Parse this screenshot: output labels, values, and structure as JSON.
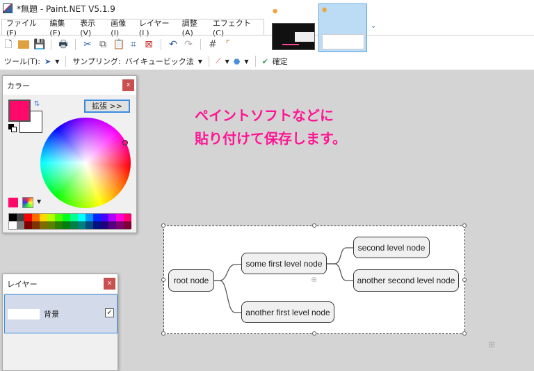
{
  "window": {
    "title": "*無題 - Paint.NET V5.1.9"
  },
  "menu": [
    "ファイル(F)",
    "編集(E)",
    "表示(V)",
    "画像(I)",
    "レイヤー(L)",
    "調整(A)",
    "エフェクト(C)"
  ],
  "toolbar2": {
    "tool_label": "ツール(T):",
    "sampling_label": "サンプリング:",
    "sampling_value": "バイキュービック法",
    "commit_label": "確定"
  },
  "color_panel": {
    "title": "カラー",
    "expand_label": "拡張 >>",
    "close": "x",
    "primary_color": "#ff0a6b",
    "secondary_color": "#ffffff",
    "palette_top": [
      "#000000",
      "#404040",
      "#ff0000",
      "#ff6a00",
      "#ffd800",
      "#b6ff00",
      "#4cff00",
      "#00ff21",
      "#00ff90",
      "#00ffff",
      "#0094ff",
      "#0026ff",
      "#4800ff",
      "#b200ff",
      "#ff00dc",
      "#ff006e"
    ],
    "palette_bottom": [
      "#ffffff",
      "#808080",
      "#7f0000",
      "#7f3300",
      "#7f6a00",
      "#5b7f00",
      "#267f00",
      "#007f0e",
      "#007f46",
      "#007f7f",
      "#004a7f",
      "#00137f",
      "#21007f",
      "#57007f",
      "#7f006e",
      "#7f0037"
    ]
  },
  "layers_panel": {
    "title": "レイヤー",
    "close": "x",
    "layers": [
      {
        "name": "背景",
        "visible": true
      }
    ]
  },
  "annotation": {
    "line1": "ペイントソフトなどに",
    "line2": "貼り付けて保存します。"
  },
  "mindmap": {
    "root": "root node",
    "n1": "some first level node",
    "n2": "another first level node",
    "n11": "second level node",
    "n12": "another second level node"
  }
}
